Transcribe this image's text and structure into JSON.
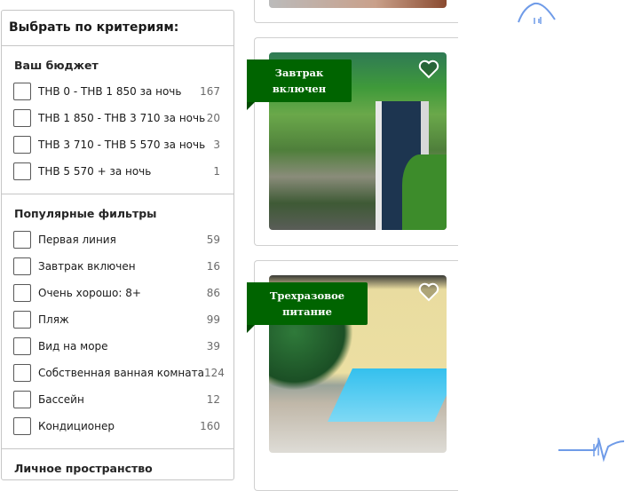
{
  "sidebar": {
    "title": "Выбрать по критериям:",
    "groups": [
      {
        "title": "Ваш бюджет",
        "items": [
          {
            "label": "THB 0 - THB 1 850 за ночь",
            "count": "167"
          },
          {
            "label": "THB 1 850 - THB 3 710 за ночь",
            "count": "20"
          },
          {
            "label": "THB 3 710 - THB 5 570 за ночь",
            "count": "3"
          },
          {
            "label": "THB 5 570 + за ночь",
            "count": "1"
          }
        ]
      },
      {
        "title": "Популярные фильтры",
        "items": [
          {
            "label": "Первая линия",
            "count": "59"
          },
          {
            "label": "Завтрак включен",
            "count": "16"
          },
          {
            "label": "Очень хорошо: 8+",
            "count": "86"
          },
          {
            "label": "Пляж",
            "count": "99"
          },
          {
            "label": "Вид на море",
            "count": "39"
          },
          {
            "label": "Собственная ванная комната",
            "count": "124"
          },
          {
            "label": "Бассейн",
            "count": "12"
          },
          {
            "label": "Кондиционер",
            "count": "160"
          }
        ]
      },
      {
        "title": "Личное пространство"
      }
    ]
  },
  "cards": [
    {
      "badge": "Завтрак включен"
    },
    {
      "badge": "Трехразовое питание"
    }
  ],
  "colors": {
    "badge": "#006400",
    "scribble": "#6f9be8"
  }
}
